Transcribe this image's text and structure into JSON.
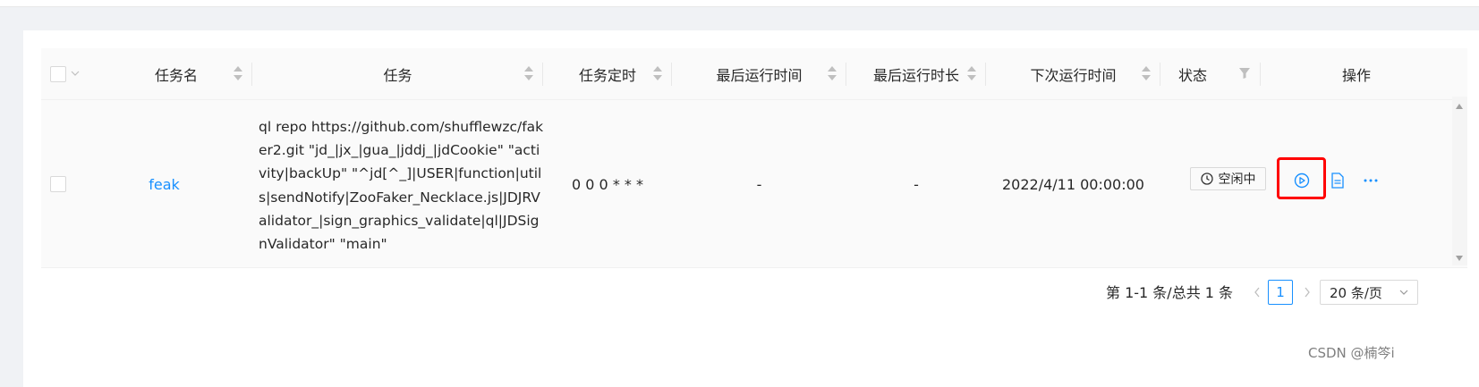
{
  "table": {
    "columns": [
      {
        "label": "任务名"
      },
      {
        "label": "任务"
      },
      {
        "label": "任务定时"
      },
      {
        "label": "最后运行时间"
      },
      {
        "label": "最后运行时长"
      },
      {
        "label": "下次运行时间"
      },
      {
        "label": "状态"
      },
      {
        "label": "操作"
      }
    ],
    "rows": [
      {
        "name": "feak",
        "command": "ql repo https://github.com/shufflewzc/faker2.git \"jd_|jx_|gua_|jddj_|jdCookie\" \"activity|backUp\" \"^jd[^_]|USER|function|utils|sendNotify|ZooFaker_Necklace.js|JDJRValidator_|sign_graphics_validate|ql|JDSignValidator\" \"main\"",
        "schedule": "0 0 0 * * *",
        "last_run_time": "-",
        "last_run_duration": "-",
        "next_run_time": "2022/4/11 00:00:00",
        "status": "空闲中"
      }
    ]
  },
  "pagination": {
    "total_text": "第 1-1 条/总共 1 条",
    "current_page": "1",
    "page_size": "20 条/页"
  },
  "icons": {
    "run": "play-circle-icon",
    "log": "file-text-icon",
    "more": "more-icon",
    "status": "clock-icon",
    "sort": "sort-icon",
    "filter": "filter-icon"
  },
  "colors": {
    "primary": "#1890ff",
    "highlight": "#ff0000"
  },
  "watermark": "CSDN @楠笒i"
}
